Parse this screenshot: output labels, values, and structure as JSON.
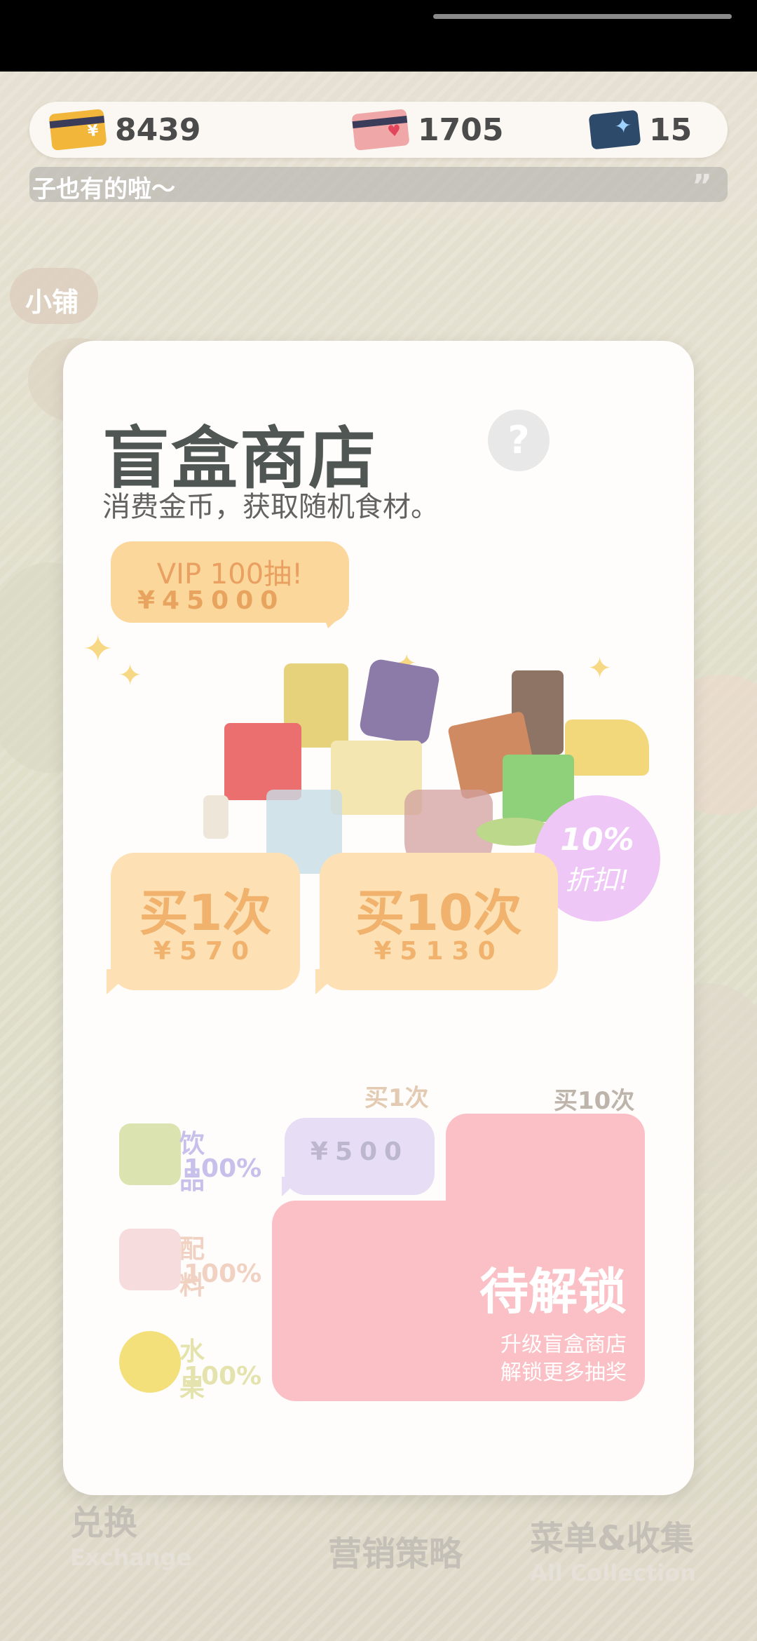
{
  "currency": {
    "gold": "8439",
    "hearts": "1705",
    "tickets": "15"
  },
  "ticker": {
    "text": "子也有的啦～"
  },
  "shop_tag": "小铺",
  "modal": {
    "title": "盲盒商店",
    "help": "?",
    "subtitle": "消费金币，获取随机食材。",
    "vip": {
      "line1": "VIP 100抽!",
      "line2": "¥45000"
    },
    "discount": {
      "line1": "10%",
      "line2": "折扣!"
    },
    "buy_once": {
      "label": "买1次",
      "price": "¥570"
    },
    "buy_ten": {
      "label": "买10次",
      "price": "¥5130"
    },
    "columns": {
      "once": "买1次",
      "ten": "买10次"
    },
    "categories": [
      {
        "name": "饮品",
        "pct": "100%",
        "color": "#c6c0ea"
      },
      {
        "name": "配料",
        "pct": "100%",
        "color": "#f1d2c2"
      },
      {
        "name": "水果",
        "pct": "100%",
        "color": "#e4e3ad"
      }
    ],
    "small_price": "¥500",
    "locked": {
      "title": "待解锁",
      "line1": "升级盲盒商店",
      "line2": "解锁更多抽奖"
    }
  },
  "nav": {
    "exchange": "兑换",
    "exchange_en": "Exchange",
    "marketing": "营销策略",
    "collection": "菜单&收集",
    "collection_en": "All Collection"
  },
  "colors": {
    "accent": "#fde1b4",
    "locked": "#fac0c5",
    "discount": "#eec7f6"
  }
}
